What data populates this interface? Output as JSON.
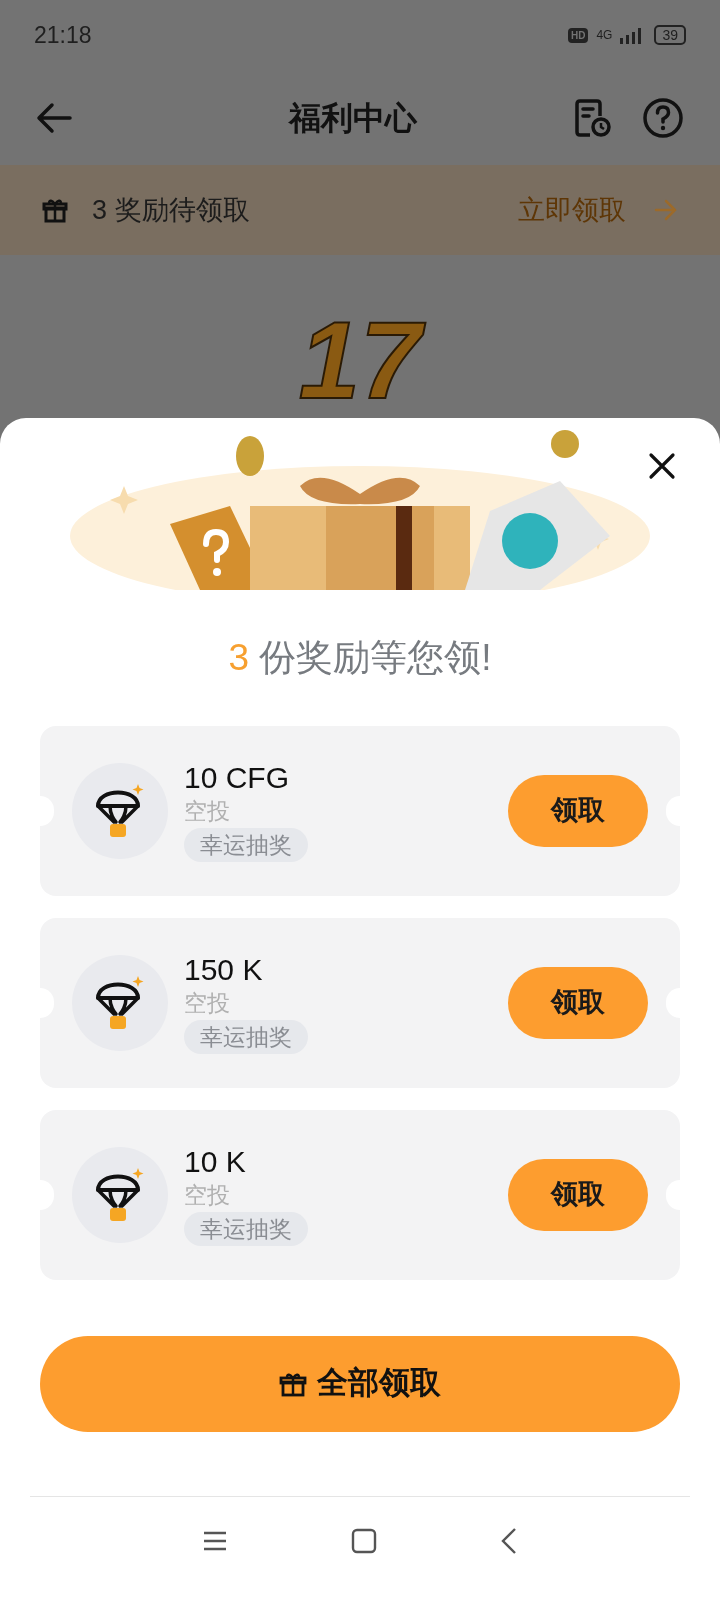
{
  "status_bar": {
    "time": "21:18",
    "battery": "39",
    "network": "4G",
    "hd": "HD"
  },
  "header": {
    "title": "福利中心"
  },
  "notice": {
    "count": "3",
    "text": "奖励待领取",
    "action": "立即领取"
  },
  "background_number": "17",
  "sheet": {
    "count": "3",
    "title": "份奖励等您领!",
    "rewards": [
      {
        "amount": "10 CFG",
        "type": "空投",
        "tag": "幸运抽奖",
        "button": "领取"
      },
      {
        "amount": "150 K",
        "type": "空投",
        "tag": "幸运抽奖",
        "button": "领取"
      },
      {
        "amount": "10 K",
        "type": "空投",
        "tag": "幸运抽奖",
        "button": "领取"
      }
    ],
    "claim_all": "全部领取"
  }
}
